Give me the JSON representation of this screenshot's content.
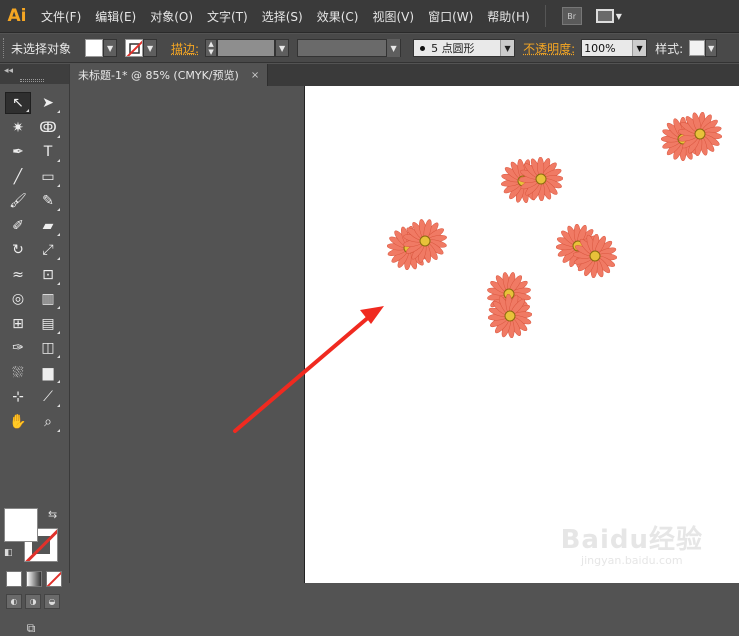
{
  "app": {
    "logo": "Ai",
    "bridge_label": "Br"
  },
  "menu": [
    "文件(F)",
    "编辑(E)",
    "对象(O)",
    "文字(T)",
    "选择(S)",
    "效果(C)",
    "视图(V)",
    "窗口(W)",
    "帮助(H)"
  ],
  "control": {
    "selection_label": "未选择对象",
    "stroke_label": "描边:",
    "brush_size": "5",
    "brush_shape": "点圆形",
    "opacity_label": "不透明度:",
    "opacity_value": "100%",
    "style_label": "样式:"
  },
  "document": {
    "tab_title": "未标题-1* @ 85% (CMYK/预览)",
    "tab_close": "×"
  },
  "toolpanel": {
    "collapse_glyph": "◂◂"
  },
  "tools": [
    {
      "name": "selection-tool-icon",
      "glyph": "↖",
      "active": true
    },
    {
      "name": "direct-selection-tool-icon",
      "glyph": "➤"
    },
    {
      "name": "magic-wand-tool-icon",
      "glyph": "✷"
    },
    {
      "name": "lasso-tool-icon",
      "glyph": "ↂ"
    },
    {
      "name": "pen-tool-icon",
      "glyph": "✒"
    },
    {
      "name": "type-tool-icon",
      "glyph": "T"
    },
    {
      "name": "line-tool-icon",
      "glyph": "╱"
    },
    {
      "name": "rectangle-tool-icon",
      "glyph": "▭"
    },
    {
      "name": "paintbrush-tool-icon",
      "glyph": "🖌"
    },
    {
      "name": "pencil-tool-icon",
      "glyph": "✎"
    },
    {
      "name": "blob-brush-tool-icon",
      "glyph": "✐"
    },
    {
      "name": "eraser-tool-icon",
      "glyph": "▰"
    },
    {
      "name": "rotate-tool-icon",
      "glyph": "↻"
    },
    {
      "name": "scale-tool-icon",
      "glyph": "⤢"
    },
    {
      "name": "warp-tool-icon",
      "glyph": "≈"
    },
    {
      "name": "free-transform-tool-icon",
      "glyph": "⊡"
    },
    {
      "name": "shape-builder-tool-icon",
      "glyph": "◎"
    },
    {
      "name": "perspective-grid-tool-icon",
      "glyph": "▥"
    },
    {
      "name": "mesh-tool-icon",
      "glyph": "⊞"
    },
    {
      "name": "gradient-tool-icon",
      "glyph": "▤"
    },
    {
      "name": "eyedropper-tool-icon",
      "glyph": "✑"
    },
    {
      "name": "blend-tool-icon",
      "glyph": "◫"
    },
    {
      "name": "symbol-sprayer-tool-icon",
      "glyph": "⛆"
    },
    {
      "name": "column-graph-tool-icon",
      "glyph": "▆"
    },
    {
      "name": "artboard-tool-icon",
      "glyph": "⊹"
    },
    {
      "name": "slice-tool-icon",
      "glyph": "⟋"
    },
    {
      "name": "hand-tool-icon",
      "glyph": "✋"
    },
    {
      "name": "zoom-tool-icon",
      "glyph": "⌕"
    }
  ],
  "colors": {
    "flower_petal": "#f07a64",
    "flower_center": "#e8c23a",
    "arrow": "#f02a20",
    "artboard": "#ffffff",
    "pasteboard": "#535353",
    "orange_label": "#f5a623"
  },
  "watermark": {
    "main": "Baidu经验",
    "sub": "jingyan.baidu.com"
  }
}
